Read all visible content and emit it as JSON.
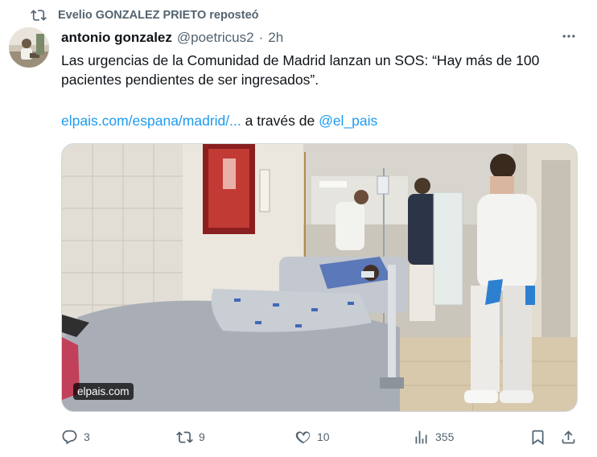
{
  "repost": {
    "reposter_text": "Evelio GONZALEZ PRIETO reposteó",
    "icon": "repost-icon"
  },
  "tweet": {
    "author_name": "antonio gonzalez",
    "handle": "@poetricus2",
    "separator": "·",
    "time": "2h",
    "text": "Las urgencias de la Comunidad de Madrid lanzan un SOS: “Hay más de 100 pacientes pendientes de ser ingresados”.",
    "link_text": "elpais.com/espana/madrid/...",
    "via_text": "a través de",
    "via_handle": "@el_pais"
  },
  "media": {
    "source_label": "elpais.com"
  },
  "actions": {
    "replies": "3",
    "reposts": "9",
    "likes": "10",
    "views": "355"
  },
  "colors": {
    "accent": "#1d9bf0",
    "secondary_text": "#536471",
    "border": "#cfd9de"
  }
}
